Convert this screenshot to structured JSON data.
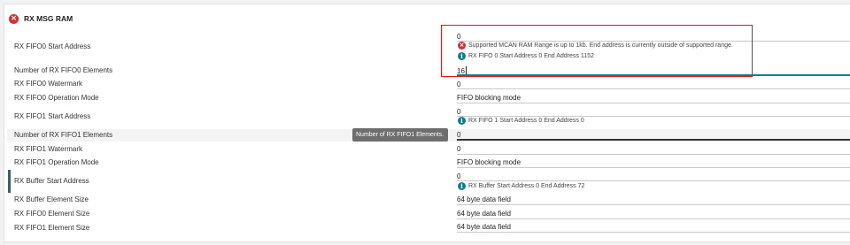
{
  "section": {
    "title": "RX MSG RAM",
    "status_icon": "error-icon"
  },
  "rows": {
    "fifo0_start": {
      "label": "RX FIFO0 Start Address",
      "value": "0",
      "error_msg": "Supported MCAN RAM Range is up to 1kb. End address is currently outside of supported range.",
      "info_msg": "RX FIFO 0 Start Address 0 End Address 1152"
    },
    "fifo0_elements": {
      "label": "Number of RX FIFO0 Elements",
      "value": "16"
    },
    "fifo0_watermark": {
      "label": "RX FIFO0 Watermark",
      "value": "0"
    },
    "fifo0_mode": {
      "label": "RX FIFO0 Operation Mode",
      "value": "FIFO blocking mode"
    },
    "fifo1_start": {
      "label": "RX FIFO1 Start Address",
      "value": "0",
      "info_msg": "RX FIFO 1 Start Address 0 End Address 0"
    },
    "fifo1_elements": {
      "label": "Number of RX FIFO1 Elements",
      "value": "0"
    },
    "fifo1_watermark": {
      "label": "RX FIFO1 Watermark",
      "value": "0"
    },
    "fifo1_mode": {
      "label": "RX FIFO1 Operation Mode",
      "value": "FIFO blocking mode"
    },
    "buffer_start": {
      "label": "RX Buffer Start Address",
      "value": "0",
      "info_msg": "RX Buffer Start Address 0 End Address 72"
    },
    "buffer_elem_size": {
      "label": "RX Buffer Element Size",
      "value": "64 byte data field"
    },
    "fifo0_elem_size": {
      "label": "RX FIFO0 Element Size",
      "value": "64 byte data field"
    },
    "fifo1_elem_size": {
      "label": "RX FIFO1 Element Size",
      "value": "64 byte data field"
    }
  },
  "tooltip": {
    "text": "Number of RX FIFO1 Elements."
  },
  "colors": {
    "error": "#d32f2f",
    "info": "#0a7f8a",
    "highlight_box": "#e0161b"
  }
}
